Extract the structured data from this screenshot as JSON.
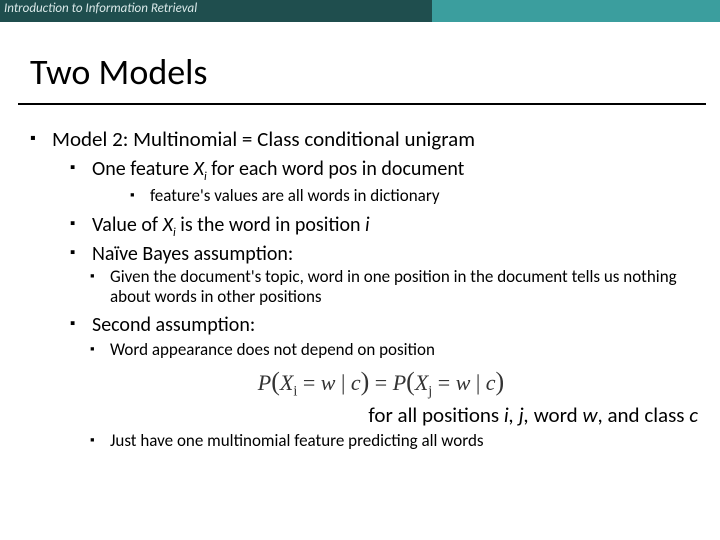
{
  "header": {
    "title": "Introduction to Information Retrieval"
  },
  "title": "Two Models",
  "b1": {
    "pre": "Model 2: Multinomial = Class conditional unigram"
  },
  "b2a": {
    "pre": "One feature ",
    "var": "X",
    "sub": "i",
    "post": " for each word pos in document"
  },
  "b3a": "feature's values are all words in dictionary",
  "b2b": {
    "pre": "Value of ",
    "var": "X",
    "sub": "i",
    "mid": " is the word in position ",
    "pos": "i"
  },
  "b2c": "Naïve Bayes assumption:",
  "b3b": "Given the document's topic, word in one position in the document tells us nothing about words in other positions",
  "b2d": "Second assumption:",
  "b3c": "Word appearance does not depend on position",
  "eq": {
    "P1": "P",
    "lp1": "(",
    "X1": "X",
    "i": "i",
    "eqw1": " = ",
    "w1": "w",
    "bar1": " | ",
    "c1": "c",
    "rp1": ")",
    "eqsign": " = ",
    "P2": "P",
    "lp2": "(",
    "X2": "X",
    "j": "j",
    "eqw2": " = ",
    "w2": "w",
    "bar2": " | ",
    "c2": "c",
    "rp2": ")"
  },
  "forall": {
    "pre": "for all positions ",
    "ij": "i, j,",
    "mid": " word ",
    "w": "w",
    "mid2": ", and class ",
    "c": "c"
  },
  "b3d": "Just have one multinomial feature predicting all words"
}
